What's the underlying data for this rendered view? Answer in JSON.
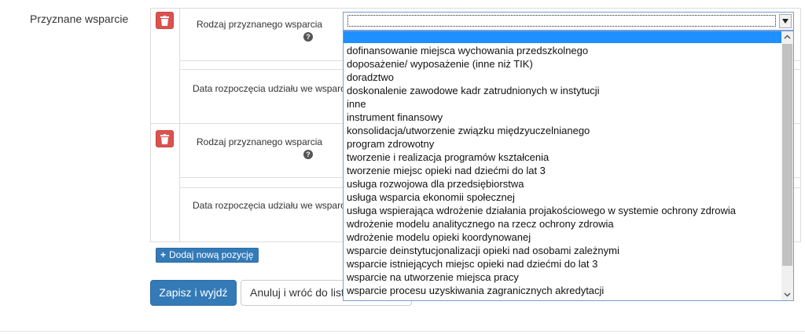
{
  "section_label": "Przyznane wsparcie",
  "groups": [
    {
      "support_type_label": "Rodzaj przyznanego wsparcia",
      "start_date_label": "Data rozpoczęcia udziału we wsparciu"
    },
    {
      "support_type_label": "Rodzaj przyznanego wsparcia",
      "start_date_label": "Data rozpoczęcia udziału we wsparciu"
    }
  ],
  "help_glyph": "?",
  "add_button": {
    "icon": "plus-icon",
    "label": "Dodaj nową pozycję"
  },
  "actions": {
    "save_label": "Zapisz i wyjdź",
    "cancel_label": "Anuluj i wróć do listy"
  },
  "dropdown": {
    "selected_value": "",
    "options": [
      "dofinansowanie miejsca wychowania przedszkolnego",
      "doposażenie/ wyposażenie (inne niż TIK)",
      "doradztwo",
      "doskonalenie zawodowe kadr zatrudnionych w instytucji",
      "inne",
      "instrument finansowy",
      "konsolidacja/utworzenie związku międzyuczelnianego",
      "program zdrowotny",
      "tworzenie i realizacja programów kształcenia",
      "tworzenie miejsc opieki nad dziećmi do lat 3",
      "usługa rozwojowa dla przedsiębiorstwa",
      "usługa wsparcia ekonomii społecznej",
      "usługa wspierająca wdrożenie działania projakościowego w systemie ochrony zdrowia",
      "wdrożenie modelu analitycznego na rzecz ochrony zdrowia",
      "wdrożenie modelu opieki koordynowanej",
      "wsparcie deinstytucjonalizacji opieki nad osobami zależnymi",
      "wsparcie istniejących miejsc opieki nad dziećmi do lat 3",
      "wsparcie na utworzenie miejsca pracy",
      "wsparcie procesu uzyskiwania zagranicznych akredytacji"
    ]
  },
  "colors": {
    "primary": "#337ab7",
    "danger": "#d9534f",
    "highlight": "#1e90ff"
  }
}
